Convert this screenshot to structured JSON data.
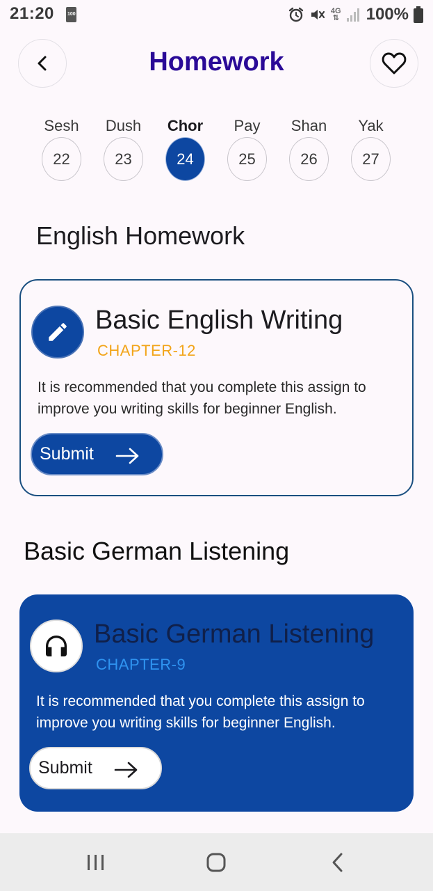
{
  "status_bar": {
    "time": "21:20",
    "battery_small_label": "100",
    "network_label_top": "4G",
    "battery_percent": "100%",
    "icons": [
      "alarm-icon",
      "mute-icon",
      "signal-icon",
      "battery-icon"
    ]
  },
  "header": {
    "title": "Homework",
    "back_icon": "chevron-left-icon",
    "favorite_icon": "heart-outline-icon"
  },
  "days": [
    {
      "name": "Sesh",
      "date": "22",
      "active": false
    },
    {
      "name": "Dush",
      "date": "23",
      "active": false
    },
    {
      "name": "Chor",
      "date": "24",
      "active": true
    },
    {
      "name": "Pay",
      "date": "25",
      "active": false
    },
    {
      "name": "Shan",
      "date": "26",
      "active": false
    },
    {
      "name": "Yak",
      "date": "27",
      "active": false
    }
  ],
  "sections": [
    {
      "heading": "English Homework",
      "card": {
        "icon": "pencil-icon",
        "title": "Basic English Writing",
        "chapter": "CHAPTER-12",
        "description": "It is recommended that you complete this assign to improve you writing skills for beginner English.",
        "submit_label": "Submit"
      }
    },
    {
      "heading": "Basic German Listening",
      "card": {
        "icon": "headphones-icon",
        "title": "Basic German Listening",
        "chapter": "CHAPTER-9",
        "description": "It is recommended that you complete this assign to improve you writing skills for beginner English.",
        "submit_label": "Submit"
      }
    }
  ],
  "colors": {
    "primary": "#0d47a1",
    "title": "#2a0a97",
    "chapter_accent_1": "#f2a51a",
    "chapter_accent_2": "#2f93f0",
    "background": "#fdf8fc"
  },
  "nav_bar": {
    "icons": [
      "recent-apps-icon",
      "home-icon",
      "back-icon"
    ]
  }
}
